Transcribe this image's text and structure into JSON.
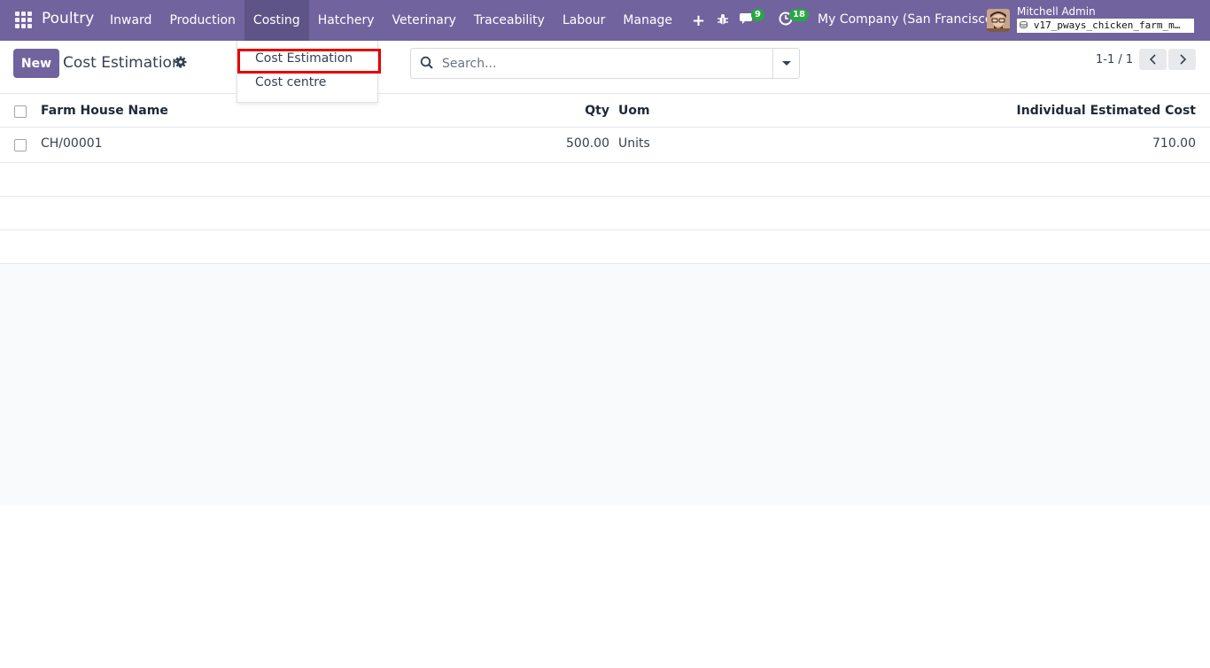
{
  "navbar": {
    "brand": "Poultry",
    "menu": [
      "Inward",
      "Production",
      "Costing",
      "Hatchery",
      "Veterinary",
      "Traceability",
      "Labour",
      "Manage"
    ],
    "messages_count": "9",
    "activities_count": "18",
    "company": "My Company (San Francisco)",
    "user_name": "Mitchell Admin",
    "database": "v17_pways_chicken_farm_m…",
    "accent": "#71639e"
  },
  "dropdown": {
    "items": [
      "Cost Estimation",
      "Cost centre"
    ]
  },
  "control_panel": {
    "new_label": "New",
    "title": "Cost Estimation",
    "search_placeholder": "Search...",
    "pager": "1-1 / 1"
  },
  "table": {
    "headers": {
      "name": "Farm House Name",
      "qty": "Qty",
      "uom": "Uom",
      "cost": "Individual Estimated Cost"
    },
    "rows": [
      {
        "name": "CH/00001",
        "qty": "500.00",
        "uom": "Units",
        "cost": "710.00"
      }
    ]
  }
}
